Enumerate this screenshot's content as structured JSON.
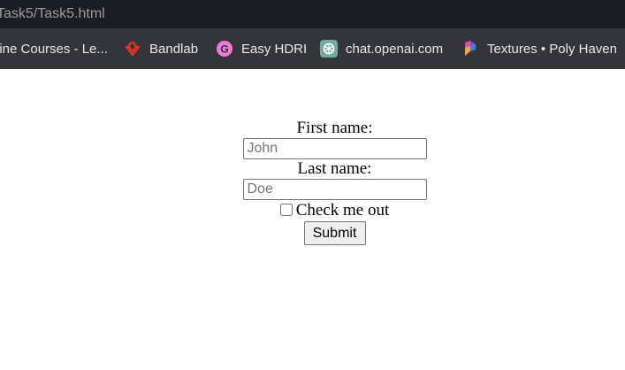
{
  "address_bar": {
    "url": "Task5/Task5.html"
  },
  "bookmarks": [
    {
      "label": "line Courses - Le...",
      "icon": "course-icon"
    },
    {
      "label": "Bandlab",
      "icon": "bandlab-icon",
      "color": "#e8331e"
    },
    {
      "label": "Easy HDRI",
      "icon": "easy-hdri-icon",
      "color": "#f07ad8"
    },
    {
      "label": "chat.openai.com",
      "icon": "openai-icon",
      "color": "#74aa9c"
    },
    {
      "label": "Textures • Poly Haven",
      "icon": "poly-haven-icon"
    }
  ],
  "form": {
    "first_name_label": "First name:",
    "first_name_placeholder": "John",
    "last_name_label": "Last name:",
    "last_name_placeholder": "Doe",
    "checkbox_label": "Check me out",
    "submit_label": "Submit"
  }
}
